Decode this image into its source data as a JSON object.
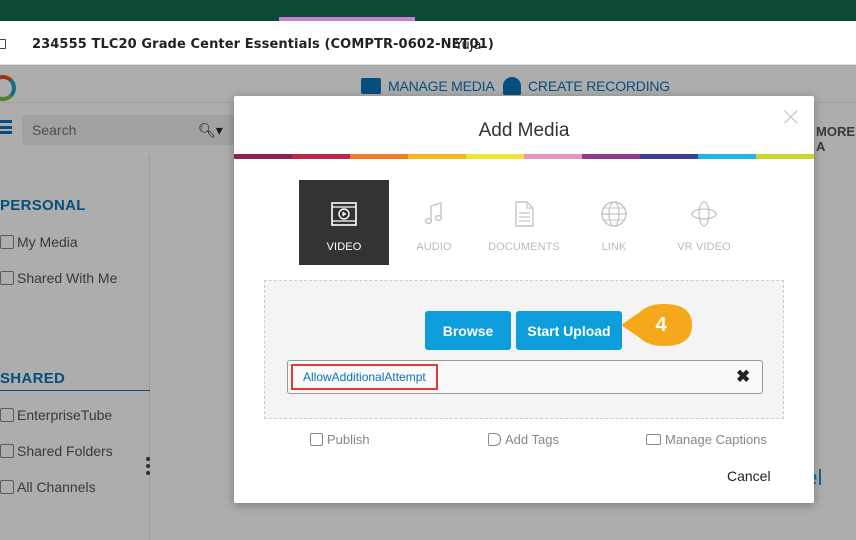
{
  "course": {
    "title": "234555 TLC20 Grade Center Essentials (COMPTR-0602-NET01)",
    "tab": "YuJa"
  },
  "app": {
    "header": {
      "manage_media": "MANAGE MEDIA",
      "create_recording": "CREATE RECORDING"
    },
    "search": {
      "placeholder": "Search"
    },
    "more": "MORE A",
    "sidebar": {
      "personal_heading": "PERSONAL",
      "personal_items": [
        "My Media",
        "Shared With Me"
      ],
      "shared_heading": "SHARED",
      "shared_items": [
        "EnterpriseTube",
        "Shared Folders",
        "All Channels"
      ]
    },
    "background_text": "nel"
  },
  "modal": {
    "title": "Add Media",
    "close": "×",
    "rainbow_colors": [
      "#8b2252",
      "#c0254a",
      "#f47b20",
      "#f5b81a",
      "#f2e532",
      "#e993c0",
      "#8a3a8f",
      "#3a3f8f",
      "#1fb5e6",
      "#c6d82f"
    ],
    "media_types": [
      {
        "label": "VIDEO",
        "icon": "video-icon",
        "active": true
      },
      {
        "label": "AUDIO",
        "icon": "music-note-icon",
        "active": false
      },
      {
        "label": "DOCUMENTS",
        "icon": "document-icon",
        "active": false
      },
      {
        "label": "LINK",
        "icon": "globe-icon",
        "active": false
      },
      {
        "label": "VR VIDEO",
        "icon": "vr-icon",
        "active": false
      }
    ],
    "browse_label": "Browse",
    "start_upload_label": "Start Upload",
    "file_name": "AllowAdditionalAttempt",
    "remove_icon": "✖",
    "actions": {
      "publish": "Publish",
      "add_tags": "Add Tags",
      "manage_captions": "Manage Captions"
    },
    "cancel_label": "Cancel"
  },
  "step_badge": {
    "number": "4",
    "color": "#f5a81a"
  },
  "colors": {
    "accent_blue": "#0d9ddb",
    "link_blue": "#0a74b9",
    "top_bar_green": "#0d4a33",
    "highlight_red": "#e53935"
  }
}
